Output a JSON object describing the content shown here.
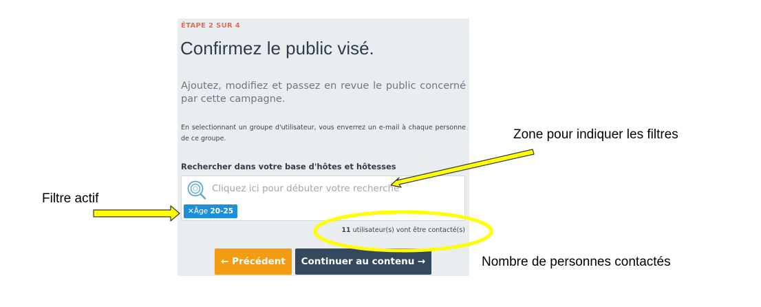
{
  "step": {
    "label": "ÉTAPE 2 SUR 4"
  },
  "page": {
    "title": "Confirmez le public visé.",
    "lead": "Ajoutez, modifiez et passez en revue le public concerné par cette campagne.",
    "note": "En selectionnant un groupe d'utilisateur, vous enverrez un e-mail à chaque personne de ce groupe."
  },
  "search": {
    "label": "Rechercher dans votre base d'hôtes et hôtesses",
    "placeholder": "Cliquez ici pour débuter votre recherche",
    "icon": "search-icon"
  },
  "filter_tag": {
    "remove": "✕",
    "name": "Âge",
    "value": "20-25"
  },
  "count": {
    "number": "11",
    "text": "utilisateur(s) vont être contacté(s)"
  },
  "buttons": {
    "previous": "← Précédent",
    "next": "Continuer au contenu →"
  },
  "annotations": {
    "filters_zone": "Zone pour indiquer les filtres",
    "active_filter": "Filtre actif",
    "people_count": "Nombre de personnes contactés"
  },
  "colors": {
    "step": "#e06d5d",
    "tag": "#1f8fd8",
    "previous_button": "#f39c12",
    "next_button": "#34495e",
    "annotation_arrow": "#ffff00"
  }
}
